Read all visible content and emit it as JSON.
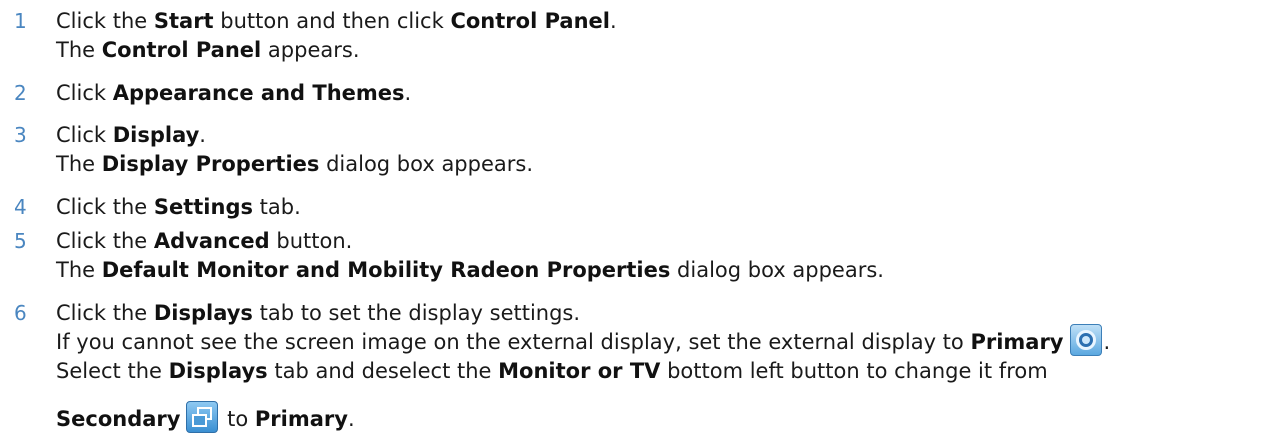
{
  "steps": [
    {
      "number": "1",
      "lines": [
        {
          "a": "Click the ",
          "b": "Start",
          "c": " button and then click ",
          "d": "Control Panel",
          "e": "."
        },
        {
          "a": "The ",
          "b": "Control Panel",
          "c": " appears."
        }
      ]
    },
    {
      "number": "2",
      "lines": [
        {
          "a": "Click ",
          "b": "Appearance and Themes",
          "c": "."
        }
      ]
    },
    {
      "number": "3",
      "lines": [
        {
          "a": "Click ",
          "b": "Display",
          "c": "."
        },
        {
          "a": "The ",
          "b": "Display Properties",
          "c": " dialog box appears."
        }
      ]
    },
    {
      "number": "4",
      "lines": [
        {
          "a": "Click the ",
          "b": "Settings",
          "c": " tab."
        }
      ]
    },
    {
      "number": "5",
      "lines": [
        {
          "a": "Click the ",
          "b": "Advanced",
          "c": " button."
        },
        {
          "a": "The ",
          "b": "Default Monitor and Mobility Radeon Properties",
          "c": " dialog box appears."
        }
      ]
    },
    {
      "number": "6",
      "lines": [
        {
          "a": "Click the ",
          "b": "Displays",
          "c": " tab to set the display settings."
        },
        {
          "a": "If you cannot see the screen image on the external display, set the external display to ",
          "b": "Primary",
          "c": "."
        },
        {
          "a": "Select the ",
          "b": "Displays",
          "c": " tab and deselect the ",
          "d": "Monitor or TV",
          "e": " bottom left button to change it from"
        },
        {
          "a": "Secondary",
          "b": " to ",
          "c": "Primary",
          "d": "."
        }
      ]
    }
  ],
  "icons": {
    "primary": "primary-display-icon",
    "secondary": "secondary-display-icon"
  }
}
